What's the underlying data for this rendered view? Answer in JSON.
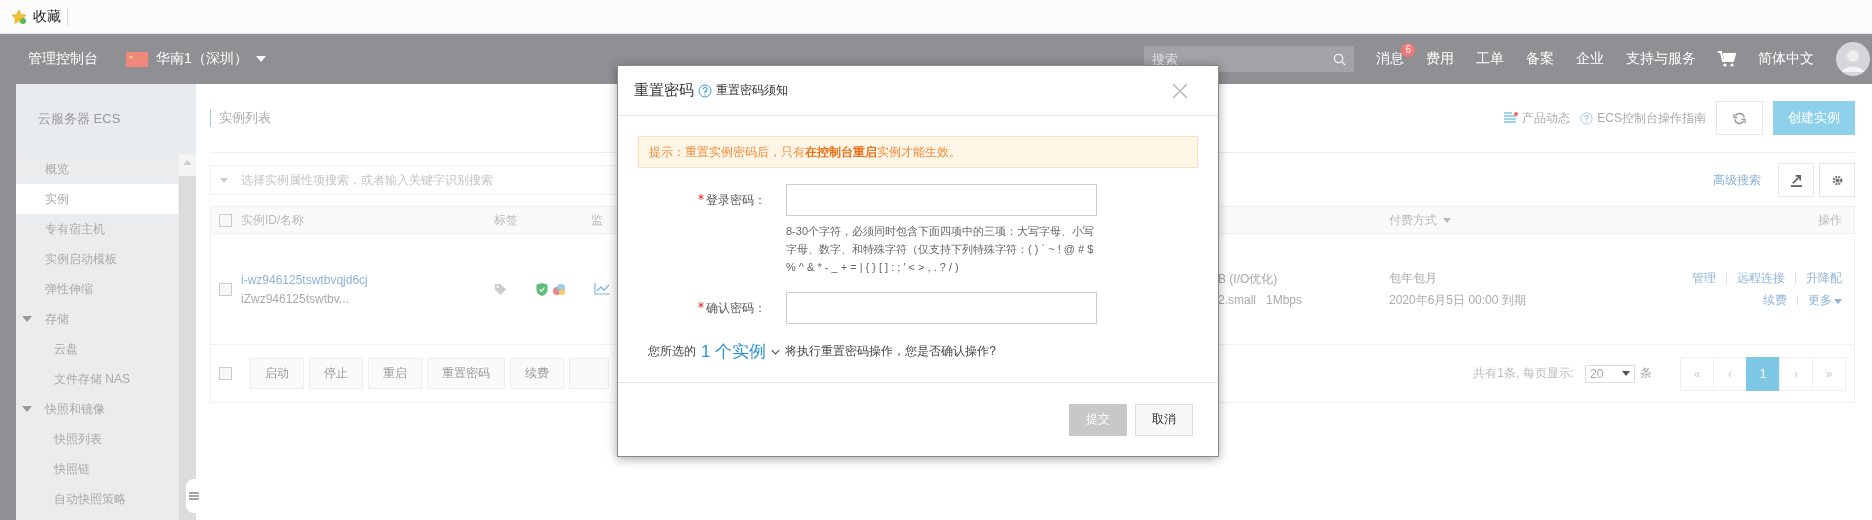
{
  "browser_bar": {
    "bookmark": "收藏"
  },
  "top_nav": {
    "console": "管理控制台",
    "region": "华南1（深圳）",
    "search": {
      "placeholder": "搜索"
    },
    "items": [
      {
        "label": "消息",
        "badge": "6"
      },
      {
        "label": "费用"
      },
      {
        "label": "工单"
      },
      {
        "label": "备案"
      },
      {
        "label": "企业"
      },
      {
        "label": "支持与服务"
      }
    ],
    "language": "简体中文"
  },
  "sidebar": {
    "title": "云服务器 ECS",
    "items": [
      {
        "label": "概览",
        "selected": false
      },
      {
        "label": "实例",
        "selected": true
      },
      {
        "label": "专有宿主机",
        "selected": false
      },
      {
        "label": "实例启动模板",
        "selected": false
      },
      {
        "label": "弹性伸缩",
        "selected": false
      },
      {
        "label": "存储",
        "selected": false,
        "expanded": true,
        "children": [
          {
            "label": "云盘",
            "selected": false
          },
          {
            "label": "文件存储 NAS",
            "selected": false
          }
        ]
      },
      {
        "label": "快照和镜像",
        "selected": false,
        "expanded": true,
        "children": [
          {
            "label": "快照列表",
            "selected": false
          },
          {
            "label": "快照链",
            "selected": false
          },
          {
            "label": "自动快照策略",
            "selected": false
          }
        ]
      }
    ]
  },
  "header": {
    "title": "实例列表",
    "links": [
      {
        "label": "产品动态",
        "kind": "news"
      },
      {
        "label": "ECS控制台操作指南",
        "kind": "help"
      }
    ],
    "create_button": "创建实例"
  },
  "toolbar": {
    "search": {
      "placeholder": "选择实例属性项搜索，或者输入关键字识别搜索"
    },
    "advanced_search": "高级搜索"
  },
  "table": {
    "select_all": {
      "checked": false
    },
    "columns": {
      "id_name": "实例ID/名称",
      "tags": "标签",
      "monitor": "监",
      "payment": "付费方式",
      "actions": "操作"
    },
    "rows": [
      {
        "checked": false,
        "id": "i-wz946125tswtbvqjd6cj",
        "name": "iZwz946125tswtbv...",
        "spec": [
          "B (I/O优化)",
          "2.small   1Mbps"
        ],
        "payment": "包年包月",
        "expiry": "2020年6月5日 00:00 到期",
        "actions": [
          [
            "管理",
            "远程连接",
            "升降配"
          ],
          [
            "续费",
            "更多"
          ]
        ]
      }
    ],
    "footer": {
      "checked": false,
      "batch_buttons": [
        "启动",
        "停止",
        "重启",
        "重置密码",
        "续费"
      ]
    }
  },
  "pagination": {
    "summary": "共有1条, 每页显示:",
    "page_size": "20",
    "unit": "条",
    "pages": [
      {
        "label": "«",
        "selected": false
      },
      {
        "label": "‹",
        "selected": false
      },
      {
        "label": "1",
        "selected": true
      },
      {
        "label": "›",
        "selected": false
      },
      {
        "label": "»",
        "selected": false
      }
    ]
  },
  "dialog": {
    "title": "重置密码",
    "help_link": "重置密码须知",
    "notice": "提示：重置实例密码后，只有**在控制台重启**实例才能生效。",
    "fields": [
      {
        "label": "登录密码：",
        "required": true,
        "hint": "8-30个字符，必须同时包含下面四项中的三项：大写字母、小写字母、数字、和特殊字符（仅支持下列特殊字符：( ) ` ~ ! @ # $ % ^ & * - _ + = | { } [ ] : ; ' < > , . ? / )"
      },
      {
        "label": "确认密码：",
        "required": true
      }
    ],
    "selection": {
      "prefix": "您所选的",
      "count": "1 个实例",
      "suffix": "将执行重置密码操作，您是否确认操作?"
    },
    "buttons": [
      {
        "label": "提交",
        "disabled": true
      },
      {
        "label": "取消",
        "disabled": false
      }
    ]
  }
}
